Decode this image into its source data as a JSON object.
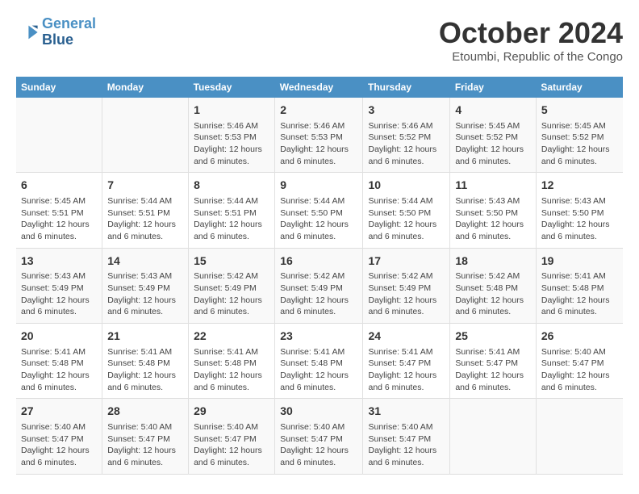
{
  "logo": {
    "line1": "General",
    "line2": "Blue"
  },
  "title": "October 2024",
  "location": "Etoumbi, Republic of the Congo",
  "columns": [
    "Sunday",
    "Monday",
    "Tuesday",
    "Wednesday",
    "Thursday",
    "Friday",
    "Saturday"
  ],
  "weeks": [
    [
      {
        "day": "",
        "info": ""
      },
      {
        "day": "",
        "info": ""
      },
      {
        "day": "1",
        "sunrise": "5:46 AM",
        "sunset": "5:53 PM",
        "daylight": "12 hours and 6 minutes."
      },
      {
        "day": "2",
        "sunrise": "5:46 AM",
        "sunset": "5:53 PM",
        "daylight": "12 hours and 6 minutes."
      },
      {
        "day": "3",
        "sunrise": "5:46 AM",
        "sunset": "5:52 PM",
        "daylight": "12 hours and 6 minutes."
      },
      {
        "day": "4",
        "sunrise": "5:45 AM",
        "sunset": "5:52 PM",
        "daylight": "12 hours and 6 minutes."
      },
      {
        "day": "5",
        "sunrise": "5:45 AM",
        "sunset": "5:52 PM",
        "daylight": "12 hours and 6 minutes."
      }
    ],
    [
      {
        "day": "6",
        "sunrise": "5:45 AM",
        "sunset": "5:51 PM",
        "daylight": "12 hours and 6 minutes."
      },
      {
        "day": "7",
        "sunrise": "5:44 AM",
        "sunset": "5:51 PM",
        "daylight": "12 hours and 6 minutes."
      },
      {
        "day": "8",
        "sunrise": "5:44 AM",
        "sunset": "5:51 PM",
        "daylight": "12 hours and 6 minutes."
      },
      {
        "day": "9",
        "sunrise": "5:44 AM",
        "sunset": "5:50 PM",
        "daylight": "12 hours and 6 minutes."
      },
      {
        "day": "10",
        "sunrise": "5:44 AM",
        "sunset": "5:50 PM",
        "daylight": "12 hours and 6 minutes."
      },
      {
        "day": "11",
        "sunrise": "5:43 AM",
        "sunset": "5:50 PM",
        "daylight": "12 hours and 6 minutes."
      },
      {
        "day": "12",
        "sunrise": "5:43 AM",
        "sunset": "5:50 PM",
        "daylight": "12 hours and 6 minutes."
      }
    ],
    [
      {
        "day": "13",
        "sunrise": "5:43 AM",
        "sunset": "5:49 PM",
        "daylight": "12 hours and 6 minutes."
      },
      {
        "day": "14",
        "sunrise": "5:43 AM",
        "sunset": "5:49 PM",
        "daylight": "12 hours and 6 minutes."
      },
      {
        "day": "15",
        "sunrise": "5:42 AM",
        "sunset": "5:49 PM",
        "daylight": "12 hours and 6 minutes."
      },
      {
        "day": "16",
        "sunrise": "5:42 AM",
        "sunset": "5:49 PM",
        "daylight": "12 hours and 6 minutes."
      },
      {
        "day": "17",
        "sunrise": "5:42 AM",
        "sunset": "5:49 PM",
        "daylight": "12 hours and 6 minutes."
      },
      {
        "day": "18",
        "sunrise": "5:42 AM",
        "sunset": "5:48 PM",
        "daylight": "12 hours and 6 minutes."
      },
      {
        "day": "19",
        "sunrise": "5:41 AM",
        "sunset": "5:48 PM",
        "daylight": "12 hours and 6 minutes."
      }
    ],
    [
      {
        "day": "20",
        "sunrise": "5:41 AM",
        "sunset": "5:48 PM",
        "daylight": "12 hours and 6 minutes."
      },
      {
        "day": "21",
        "sunrise": "5:41 AM",
        "sunset": "5:48 PM",
        "daylight": "12 hours and 6 minutes."
      },
      {
        "day": "22",
        "sunrise": "5:41 AM",
        "sunset": "5:48 PM",
        "daylight": "12 hours and 6 minutes."
      },
      {
        "day": "23",
        "sunrise": "5:41 AM",
        "sunset": "5:48 PM",
        "daylight": "12 hours and 6 minutes."
      },
      {
        "day": "24",
        "sunrise": "5:41 AM",
        "sunset": "5:47 PM",
        "daylight": "12 hours and 6 minutes."
      },
      {
        "day": "25",
        "sunrise": "5:41 AM",
        "sunset": "5:47 PM",
        "daylight": "12 hours and 6 minutes."
      },
      {
        "day": "26",
        "sunrise": "5:40 AM",
        "sunset": "5:47 PM",
        "daylight": "12 hours and 6 minutes."
      }
    ],
    [
      {
        "day": "27",
        "sunrise": "5:40 AM",
        "sunset": "5:47 PM",
        "daylight": "12 hours and 6 minutes."
      },
      {
        "day": "28",
        "sunrise": "5:40 AM",
        "sunset": "5:47 PM",
        "daylight": "12 hours and 6 minutes."
      },
      {
        "day": "29",
        "sunrise": "5:40 AM",
        "sunset": "5:47 PM",
        "daylight": "12 hours and 6 minutes."
      },
      {
        "day": "30",
        "sunrise": "5:40 AM",
        "sunset": "5:47 PM",
        "daylight": "12 hours and 6 minutes."
      },
      {
        "day": "31",
        "sunrise": "5:40 AM",
        "sunset": "5:47 PM",
        "daylight": "12 hours and 6 minutes."
      },
      {
        "day": "",
        "info": ""
      },
      {
        "day": "",
        "info": ""
      }
    ]
  ]
}
